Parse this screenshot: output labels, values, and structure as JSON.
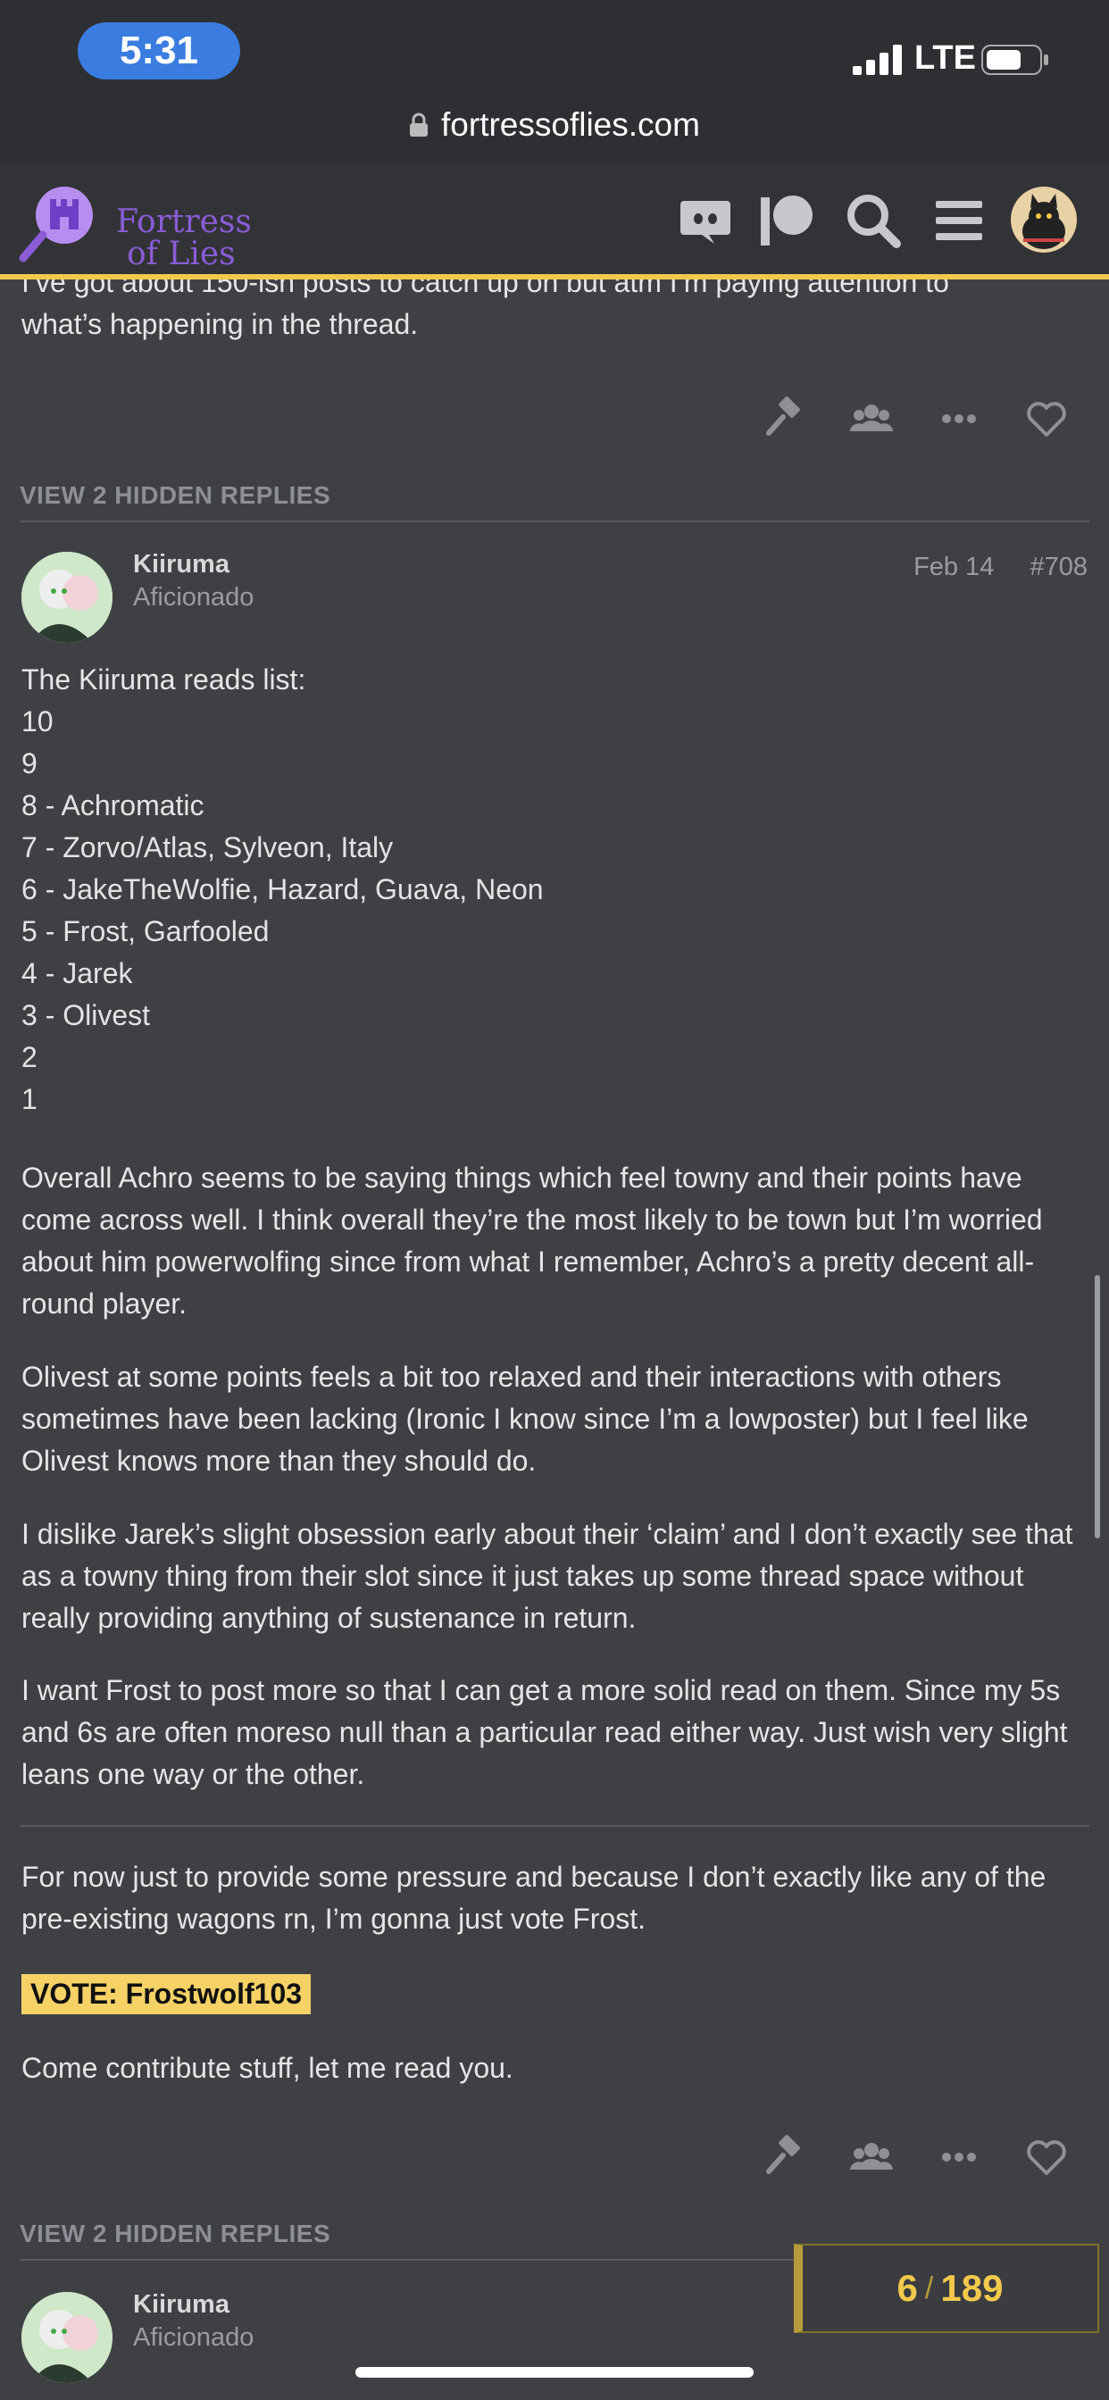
{
  "status_bar": {
    "time": "5:31",
    "network": "LTE"
  },
  "url_bar": {
    "domain": "fortressoflies.com"
  },
  "site": {
    "logo_line1": "Fortress",
    "logo_line2": "of Lies"
  },
  "colors": {
    "accent": "#f2c94c",
    "brand": "#8a5cd6",
    "vote_highlight": "#f6d266"
  },
  "header_icons": [
    "discord-icon",
    "patreon-icon",
    "search-icon",
    "hamburger-menu-icon",
    "user-avatar"
  ],
  "prev_post": {
    "text_line1": "I’ve got about 150-ish posts to catch up on but atm I’m paying attention to",
    "text_line2": "what’s happening in the thread."
  },
  "hidden_replies_label": "VIEW 2 HIDDEN REPLIES",
  "post": {
    "username": "Kiiruma",
    "user_title": "Aficionado",
    "date": "Feb 14",
    "number": "#708",
    "reads_title": "The Kiiruma reads list:",
    "reads": [
      "10",
      "9",
      "8 - Achromatic",
      "7 - Zorvo/Atlas, Sylveon, Italy",
      "6 - JakeTheWolfie, Hazard, Guava, Neon",
      "5 - Frost, Garfooled",
      "4 - Jarek",
      "3 - Olivest",
      "2",
      "1"
    ],
    "paragraphs": [
      "Overall Achro seems to be saying things which feel towny and their points have come across well. I think overall they’re the most likely to be town but I’m worried about him powerwolfing since from what I remember, Achro’s a pretty decent all-round player.",
      "Olivest at some points feels a bit too relaxed and their interactions with others sometimes have been lacking (Ironic I know since I’m a lowposter) but I feel like Olivest knows more than they should do.",
      "I dislike Jarek’s slight obsession early about their ‘claim’ and I don’t exactly see that as a towny thing from their slot since it just takes up some thread space without really providing anything of sustenance in return.",
      "I want Frost to post more so that I can get a more solid read on them. Since my 5s and 6s are often moreso null than a particular read either way. Just wish very slight leans one way or the other."
    ],
    "after_divider": "For now just to provide some pressure and because I don’t exactly like any of the pre-existing wagons rn, I’m gonna just vote Frost.",
    "vote": "VOTE: Frostwolf103",
    "closing": "Come contribute stuff, let me read you."
  },
  "next_post": {
    "username": "Kiiruma",
    "user_title": "Aficionado"
  },
  "progress": {
    "current": "6",
    "separator": "/",
    "total": "189"
  }
}
